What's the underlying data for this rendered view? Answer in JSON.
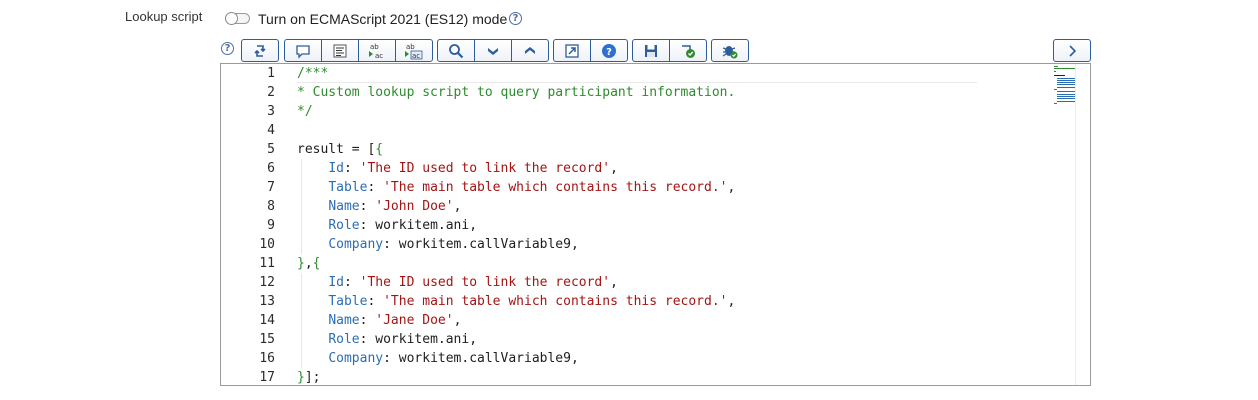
{
  "field": {
    "label": "Lookup script",
    "toggle_label": "Turn on ECMAScript 2021 (ES12) mode",
    "toggle_on": false
  },
  "help_glyph": "?",
  "toolbar": {
    "groups": [
      [
        "swap-icon"
      ],
      [
        "comment-icon",
        "format-icon",
        "replace-icon",
        "replace-all-icon"
      ],
      [
        "search-icon",
        "chevron-down-icon",
        "chevron-up-icon"
      ],
      [
        "popout-icon",
        "help-icon"
      ],
      [
        "save-icon",
        "validate-icon"
      ],
      [
        "debug-icon"
      ]
    ],
    "next_icon": "chevron-right-icon",
    "replace_glyph_top": "ab",
    "replace_glyph_bottom": "ac"
  },
  "editor": {
    "line_numbers": [
      "1",
      "2",
      "3",
      "4",
      "5",
      "6",
      "7",
      "8",
      "9",
      "10",
      "11",
      "12",
      "13",
      "14",
      "15",
      "16",
      "17"
    ],
    "lines": [
      [
        [
          "com",
          "/***"
        ]
      ],
      [
        [
          "com",
          "* Custom lookup script to query participant information."
        ]
      ],
      [
        [
          "com",
          "*/"
        ]
      ],
      [],
      [
        [
          "txt",
          "result = ["
        ],
        [
          "br",
          "{"
        ]
      ],
      [
        [
          "txt",
          "    "
        ],
        [
          "key",
          "Id"
        ],
        [
          "txt",
          ": "
        ],
        [
          "str",
          "'The ID used to link the record'"
        ],
        [
          "txt",
          ","
        ]
      ],
      [
        [
          "txt",
          "    "
        ],
        [
          "key",
          "Table"
        ],
        [
          "txt",
          ": "
        ],
        [
          "str",
          "'The main table which contains this record.'"
        ],
        [
          "txt",
          ","
        ]
      ],
      [
        [
          "txt",
          "    "
        ],
        [
          "key",
          "Name"
        ],
        [
          "txt",
          ": "
        ],
        [
          "str",
          "'John Doe'"
        ],
        [
          "txt",
          ","
        ]
      ],
      [
        [
          "txt",
          "    "
        ],
        [
          "key",
          "Role"
        ],
        [
          "txt",
          ": workitem.ani,"
        ]
      ],
      [
        [
          "txt",
          "    "
        ],
        [
          "key",
          "Company"
        ],
        [
          "txt",
          ": workitem.callVariable9,"
        ]
      ],
      [
        [
          "br",
          "}"
        ],
        [
          "txt",
          ","
        ],
        [
          "br",
          "{"
        ]
      ],
      [
        [
          "txt",
          "    "
        ],
        [
          "key",
          "Id"
        ],
        [
          "txt",
          ": "
        ],
        [
          "str",
          "'The ID used to link the record'"
        ],
        [
          "txt",
          ","
        ]
      ],
      [
        [
          "txt",
          "    "
        ],
        [
          "key",
          "Table"
        ],
        [
          "txt",
          ": "
        ],
        [
          "str",
          "'The main table which contains this record.'"
        ],
        [
          "txt",
          ","
        ]
      ],
      [
        [
          "txt",
          "    "
        ],
        [
          "key",
          "Name"
        ],
        [
          "txt",
          ": "
        ],
        [
          "str",
          "'Jane Doe'"
        ],
        [
          "txt",
          ","
        ]
      ],
      [
        [
          "txt",
          "    "
        ],
        [
          "key",
          "Role"
        ],
        [
          "txt",
          ": workitem.ani,"
        ]
      ],
      [
        [
          "txt",
          "    "
        ],
        [
          "key",
          "Company"
        ],
        [
          "txt",
          ": workitem.callVariable9,"
        ]
      ],
      [
        [
          "br",
          "}"
        ],
        [
          "txt",
          "];"
        ]
      ]
    ],
    "colors": {
      "comment": "#2e8b2e",
      "string": "#a31515",
      "key": "#2a6db5",
      "text": "#1e1e1e"
    }
  }
}
